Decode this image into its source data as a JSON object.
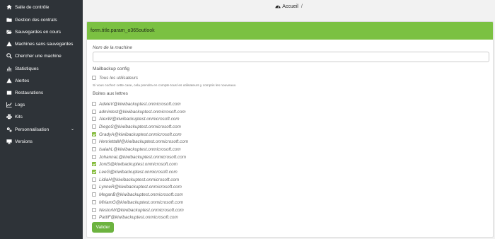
{
  "sidebar": {
    "items": [
      {
        "label": "Salle de contrôle",
        "icon": "home-icon"
      },
      {
        "label": "Gestion des contrats",
        "icon": "folder-icon"
      },
      {
        "label": "Sauvegardes en cours",
        "icon": "folder-open-icon"
      },
      {
        "label": "Machines sans sauvegardes",
        "icon": "warning-icon"
      },
      {
        "label": "Chercher une machine",
        "icon": "search-icon"
      },
      {
        "label": "Statistiques",
        "icon": "bar-chart-icon"
      },
      {
        "label": "Alertes",
        "icon": "warning-icon"
      },
      {
        "label": "Restaurations",
        "icon": "restore-icon"
      },
      {
        "label": "Logs",
        "icon": "line-chart-icon"
      },
      {
        "label": "Kits",
        "icon": "print-icon"
      },
      {
        "label": "Personnalisation",
        "icon": "gears-icon",
        "chevron": "⌄"
      },
      {
        "label": "Versions",
        "icon": "desktop-icon"
      }
    ]
  },
  "breadcrumb": {
    "home": "Accueil",
    "separator": "/"
  },
  "card": {
    "header": "form.title.param_o365outlook",
    "machine_label": "Nom de la machine",
    "machine_value": "",
    "config_label": "Mailbackup config",
    "all_users_label": "Tous les utilisateurs",
    "all_users_checked": false,
    "hint": "Si vous cochez cette case, cela prendra en compte tous les utilisateurs y compris les nouveaux.",
    "mailboxes_label": "Boites aux lettres",
    "mailboxes": [
      {
        "email": "AdeleV@kiwibackuptest.onmicrosoft.com",
        "checked": false
      },
      {
        "email": "admintest@kiwibackuptest.onmicrosoft.com",
        "checked": false
      },
      {
        "email": "AlexW@kiwibackuptest.onmicrosoft.com",
        "checked": false
      },
      {
        "email": "DiegoS@kiwibackuptest.onmicrosoft.com",
        "checked": false
      },
      {
        "email": "GradyA@kiwibackuptest.onmicrosoft.com",
        "checked": true
      },
      {
        "email": "HenriettaM@kiwibackuptest.onmicrosoft.com",
        "checked": false
      },
      {
        "email": "IsaiahL@kiwibackuptest.onmicrosoft.com",
        "checked": false
      },
      {
        "email": "JohannaL@kiwibackuptest.onmicrosoft.com",
        "checked": false
      },
      {
        "email": "JoniS@kiwibackuptest.onmicrosoft.com",
        "checked": true
      },
      {
        "email": "LeeG@kiwibackuptest.onmicrosoft.com",
        "checked": true
      },
      {
        "email": "LidiaH@kiwibackuptest.onmicrosoft.com",
        "checked": false
      },
      {
        "email": "LynneR@kiwibackuptest.onmicrosoft.com",
        "checked": false
      },
      {
        "email": "MeganB@kiwibackuptest.onmicrosoft.com",
        "checked": false
      },
      {
        "email": "MiriamG@kiwibackuptest.onmicrosoft.com",
        "checked": false
      },
      {
        "email": "NestorW@kiwibackuptest.onmicrosoft.com",
        "checked": false
      },
      {
        "email": "PattiF@kiwibackuptest.onmicrosoft.com",
        "checked": false
      }
    ],
    "submit_label": "Valider"
  },
  "colors": {
    "sidebar": "#2e3338",
    "accent": "#7bc142",
    "button": "#6cb33f"
  }
}
